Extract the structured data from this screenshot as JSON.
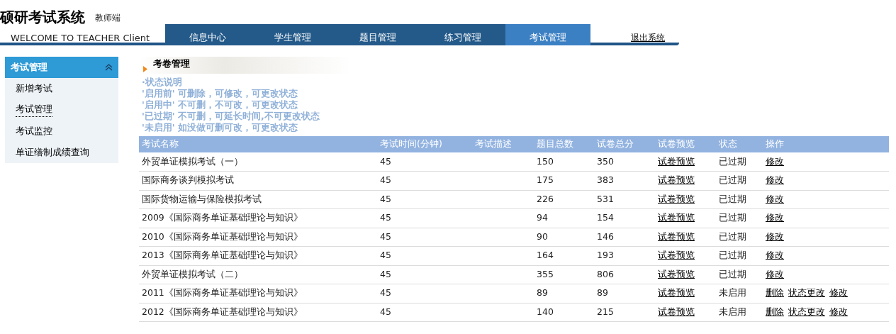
{
  "header": {
    "title": "硕研考试系统",
    "subtitle": "教师端",
    "welcome": "WELCOME TO TEACHER Client",
    "logout": "退出系统"
  },
  "tabs": [
    {
      "label": "信息中心",
      "selected": false
    },
    {
      "label": "学生管理",
      "selected": false
    },
    {
      "label": "题目管理",
      "selected": false
    },
    {
      "label": "练习管理",
      "selected": false
    },
    {
      "label": "考试管理",
      "selected": true
    }
  ],
  "sidebar": {
    "title": "考试管理",
    "expanded": true,
    "items": [
      {
        "label": "新增考试",
        "selected": false
      },
      {
        "label": "考试管理",
        "selected": true
      },
      {
        "label": "考试监控",
        "selected": false
      },
      {
        "label": "单证缮制成绩查询",
        "selected": false
      }
    ]
  },
  "section_title": "考卷管理",
  "legend": [
    "·状态说明",
    "'启用前' 可删除，可修改，可更改状态",
    "'启用中' 不可删，不可改，可更改状态",
    "'已过期' 不可删，可延长时间,不可更改状态",
    "'未启用' 如没做可删可改，可更改状态"
  ],
  "table": {
    "columns": [
      "考试名称",
      "考试时间(分钟)",
      "考试描述",
      "题目总数",
      "试卷总分",
      "试卷预览",
      "状态",
      "操作"
    ],
    "rows": [
      {
        "name": "外贸单证模拟考试（一）",
        "minutes": "45",
        "questions": "150",
        "score": "350",
        "preview": "试卷预览",
        "status": "已过期",
        "actions": [
          "修改"
        ]
      },
      {
        "name": "国际商务谈判模拟考试",
        "minutes": "45",
        "questions": "175",
        "score": "383",
        "preview": "试卷预览",
        "status": "已过期",
        "actions": [
          "修改"
        ]
      },
      {
        "name": "国际货物运输与保险模拟考试",
        "minutes": "45",
        "questions": "226",
        "score": "531",
        "preview": "试卷预览",
        "status": "已过期",
        "actions": [
          "修改"
        ]
      },
      {
        "name": "2009《国际商务单证基础理论与知识》",
        "minutes": "45",
        "questions": "94",
        "score": "154",
        "preview": "试卷预览",
        "status": "已过期",
        "actions": [
          "修改"
        ]
      },
      {
        "name": "2010《国际商务单证基础理论与知识》",
        "minutes": "45",
        "questions": "90",
        "score": "146",
        "preview": "试卷预览",
        "status": "已过期",
        "actions": [
          "修改"
        ]
      },
      {
        "name": "2013《国际商务单证基础理论与知识》",
        "minutes": "45",
        "questions": "164",
        "score": "193",
        "preview": "试卷预览",
        "status": "已过期",
        "actions": [
          "修改"
        ]
      },
      {
        "name": "外贸单证模拟考试（二）",
        "minutes": "45",
        "questions": "355",
        "score": "806",
        "preview": "试卷预览",
        "status": "已过期",
        "actions": [
          "修改"
        ]
      },
      {
        "name": "2011《国际商务单证基础理论与知识》",
        "minutes": "45",
        "questions": "89",
        "score": "89",
        "preview": "试卷预览",
        "status": "未启用",
        "actions": [
          "删除",
          "状态更改",
          "修改"
        ]
      },
      {
        "name": "2012《国际商务单证基础理论与知识》",
        "minutes": "45",
        "questions": "140",
        "score": "215",
        "preview": "试卷预览",
        "status": "未启用",
        "actions": [
          "删除",
          "状态更改",
          "修改"
        ]
      }
    ]
  }
}
